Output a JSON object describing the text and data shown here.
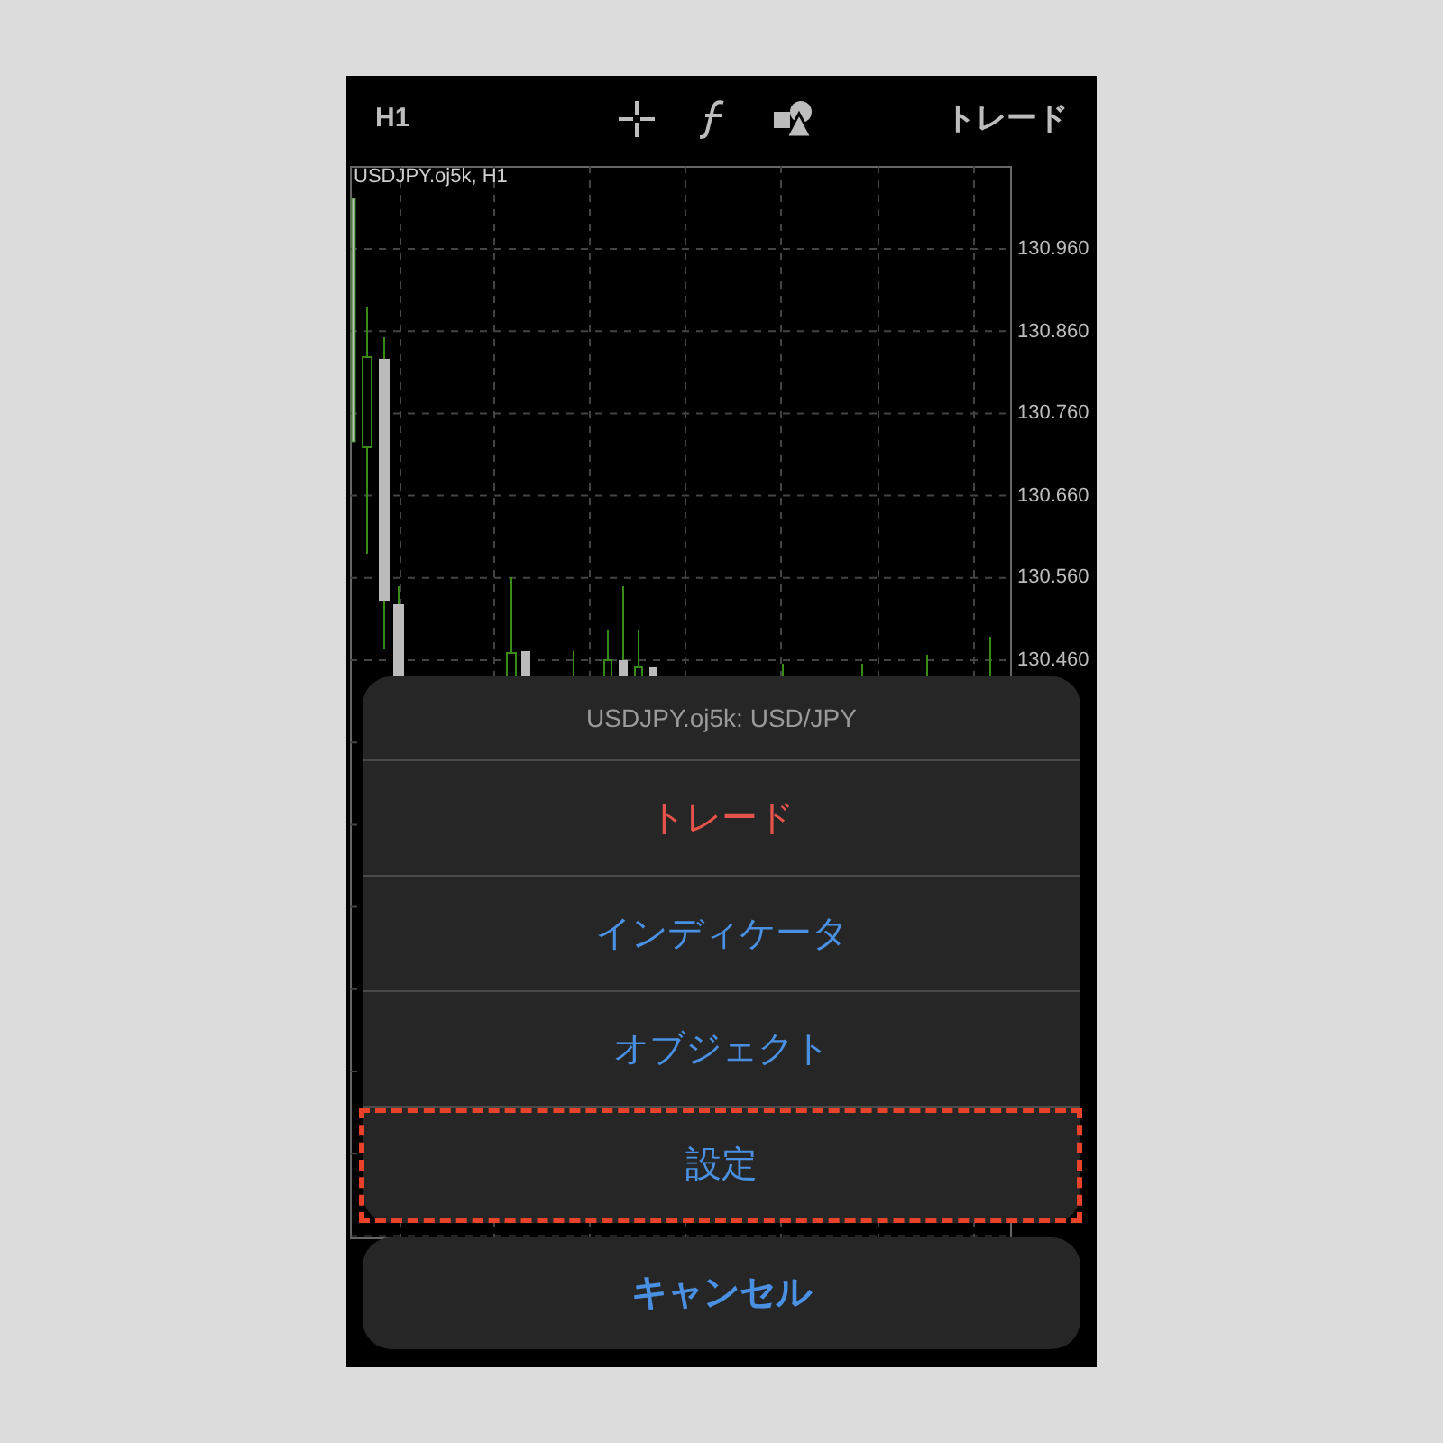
{
  "top_bar": {
    "timeframe": "H1",
    "trade_button": "トレード"
  },
  "chart": {
    "symbol_label": "USDJPY.oj5k, H1",
    "price_labels": [
      "130.960",
      "130.860",
      "130.760",
      "130.660",
      "130.560",
      "130.460"
    ]
  },
  "action_sheet": {
    "title": "USDJPY.oj5k: USD/JPY",
    "items": [
      {
        "label": "トレード",
        "kind": "destructive",
        "highlighted": false
      },
      {
        "label": "インディケータ",
        "kind": "default",
        "highlighted": false
      },
      {
        "label": "オブジェクト",
        "kind": "default",
        "highlighted": false
      },
      {
        "label": "設定",
        "kind": "default",
        "highlighted": true
      }
    ],
    "cancel": "キャンセル"
  }
}
